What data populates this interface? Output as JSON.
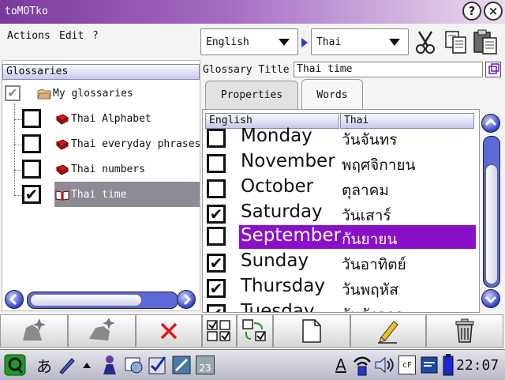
{
  "window": {
    "title": "toMOTko"
  },
  "titlebar_buttons": {
    "help": "?",
    "close": "×"
  },
  "menu": {
    "actions": "Actions",
    "edit": "Edit",
    "help": "?"
  },
  "toolbar": {
    "source_language": "English",
    "target_language": "Thai",
    "icons": [
      "cut-icon",
      "copy-icon",
      "paste-icon"
    ]
  },
  "glossaries": {
    "header": "Glossaries",
    "root": {
      "label": "My glossaries",
      "checked": true
    },
    "items": [
      {
        "label": "Thai Alphabet",
        "checked": false
      },
      {
        "label": "Thai everyday phrases",
        "checked": false
      },
      {
        "label": "Thai numbers",
        "checked": false
      },
      {
        "label": "Thai time",
        "checked": true,
        "selected": true
      }
    ]
  },
  "glossary_title": {
    "label": "Glossary Title",
    "value": "Thai time"
  },
  "tabs": {
    "properties": "Properties",
    "words": "Words",
    "active": "Words"
  },
  "words": {
    "columns": {
      "english": "English",
      "thai": "Thai"
    },
    "rows": [
      {
        "english": "Monday",
        "thai": "วันจันทร",
        "checked": false
      },
      {
        "english": "November",
        "thai": "พฤศจิกายน",
        "checked": false
      },
      {
        "english": "October",
        "thai": "ตุลาคม",
        "checked": false
      },
      {
        "english": "Saturday",
        "thai": "วันเสาร์",
        "checked": true
      },
      {
        "english": "September",
        "thai": "กันยายน",
        "checked": false,
        "selected": true
      },
      {
        "english": "Sunday",
        "thai": "วันอาทิตย์",
        "checked": true
      },
      {
        "english": "Thursday",
        "thai": "วันพฤหัส",
        "checked": true
      },
      {
        "english": "Tuesday",
        "thai": "วันอังคาร",
        "checked": true
      }
    ]
  },
  "taskbar": {
    "clock": "22:07",
    "input_method": "あ",
    "keyboard_label": "A",
    "cf_label": "cF",
    "calendar_day": "23"
  },
  "colors": {
    "selection": "#8a10c8",
    "titlebar": "#7a3a9c",
    "scroll_button": "#3242c8"
  }
}
